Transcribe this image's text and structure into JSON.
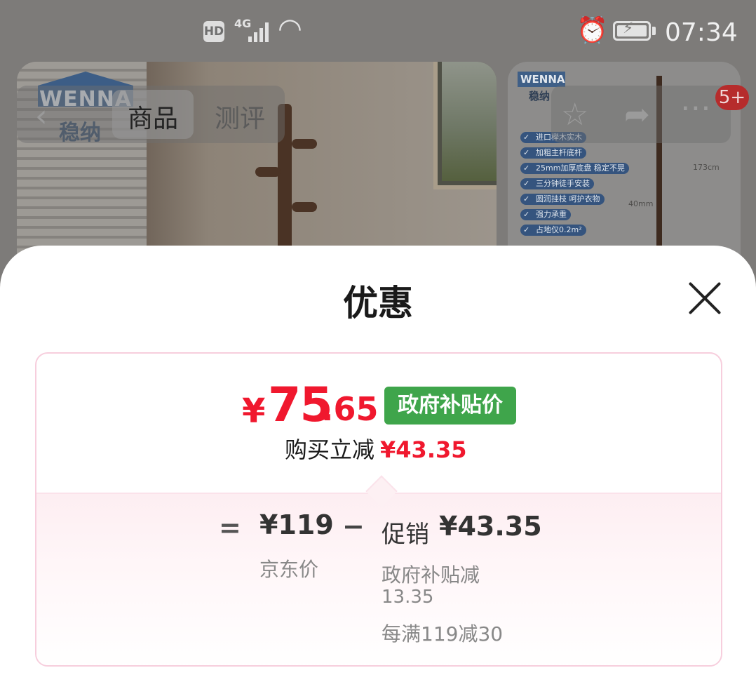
{
  "status_bar": {
    "hd": "HD",
    "network": "4G",
    "time": "07:34"
  },
  "background": {
    "brand_en": "WENNA",
    "brand_cn": "稳纳",
    "tabs": [
      "商品",
      "测评"
    ],
    "cart_badge": "5+",
    "side_features": [
      "进口榉木实木",
      "加粗主杆底杆",
      "25mm加厚底盘 稳定不晃",
      "三分钟徒手安装",
      "圆润挂枝 呵护衣物",
      "强力承重",
      "占地仅0.2m²"
    ],
    "side_dims": [
      "173cm",
      "40mm"
    ]
  },
  "sheet": {
    "title": "优惠",
    "price": {
      "currency": "¥",
      "integer": "75",
      "decimal": ".65",
      "tag": "政府补贴价"
    },
    "reduce_label": "购买立减",
    "reduce_amount": "¥43.35",
    "breakdown": {
      "eq": "=",
      "jd_price": "¥119",
      "jd_label": "京东价",
      "minus": "−",
      "promo_label": "促销",
      "promo_amount": "¥43.35",
      "promo_detail_1a": "政府补贴减",
      "promo_detail_1b": "13.35",
      "promo_detail_2": "每满119减30"
    }
  },
  "colors": {
    "price_red": "#f0182e",
    "tag_green": "#3fa54b",
    "card_border": "#f7cedd"
  }
}
